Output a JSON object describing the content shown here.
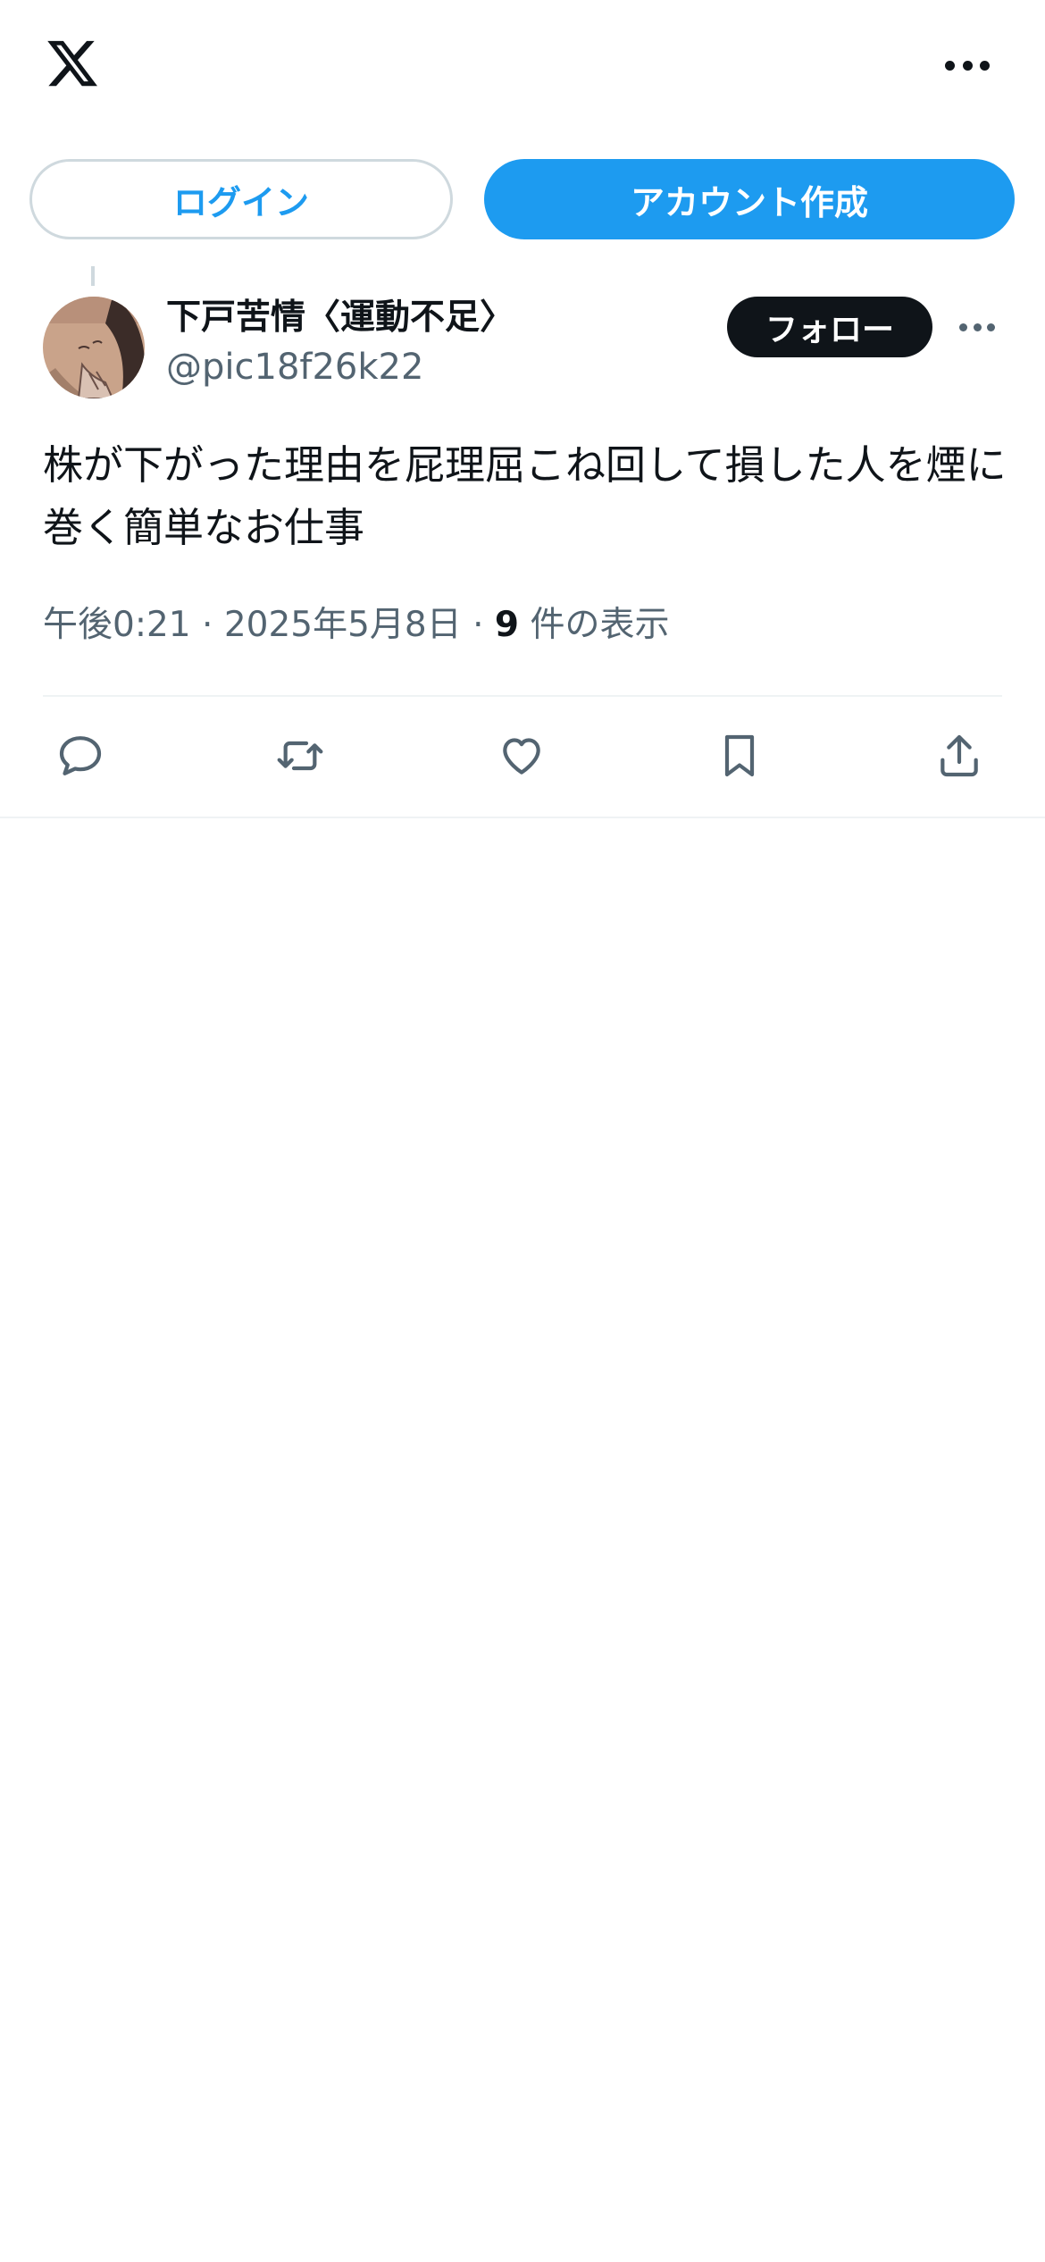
{
  "header": {
    "logo_icon": "x-logo-icon",
    "more_icon": "more-horizontal-icon"
  },
  "auth": {
    "login_label": "ログイン",
    "signup_label": "アカウント作成"
  },
  "tweet": {
    "display_name": "下戸苦情〈運動不足〉",
    "handle": "@pic18f26k22",
    "follow_label": "フォロー",
    "text": "株が下がった理由を屁理屈こね回して損した人を煙に巻く簡単なお仕事",
    "time": "午後0:21",
    "separator": "·",
    "date": "2025年5月8日",
    "views_count": "9",
    "views_label": "件の表示"
  },
  "actions": {
    "reply_icon": "reply-icon",
    "retweet_icon": "retweet-icon",
    "like_icon": "heart-icon",
    "bookmark_icon": "bookmark-icon",
    "share_icon": "share-icon"
  },
  "colors": {
    "accent": "#1d9bf0",
    "text_primary": "#0f1419",
    "text_secondary": "#536471",
    "border": "#cfd9de"
  }
}
